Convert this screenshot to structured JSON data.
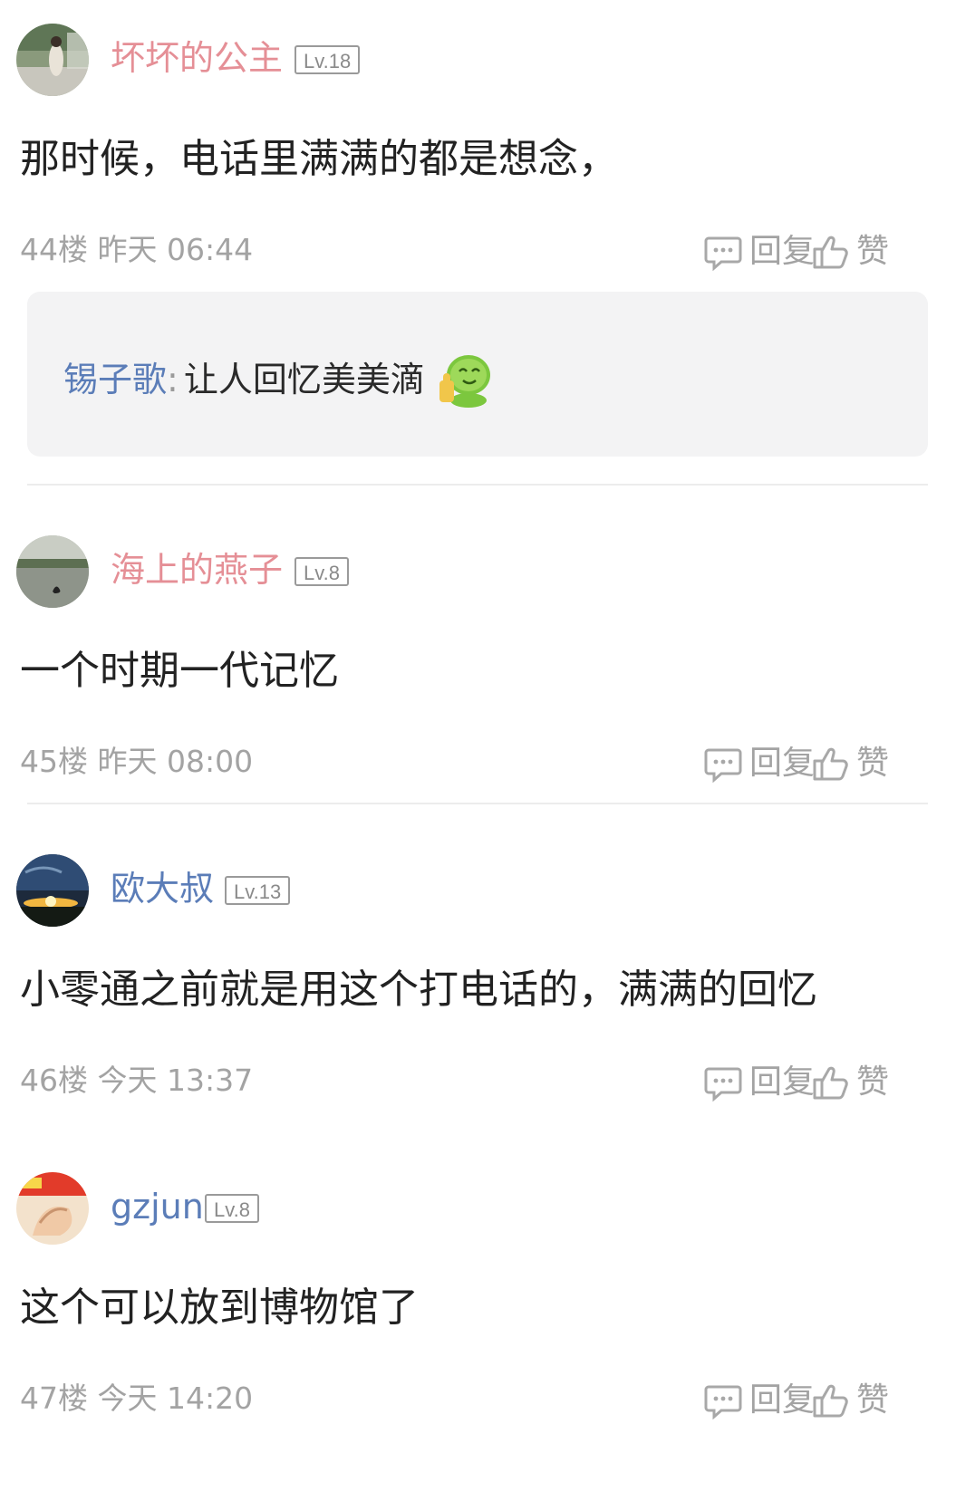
{
  "posts": [
    {
      "username": "坏坏的公主",
      "level": "Lv.18",
      "content": "那时候，电话里满满的都是想念，",
      "meta": "44楼 昨天 06:44",
      "reply_label": "回复",
      "like_label": "赞",
      "name_color": "#e58f96",
      "sub_reply": {
        "user": "锡子歌",
        "colon": ":",
        "text": "让人回忆美美滴",
        "emoji": "thumbs-up-green-emoji"
      }
    },
    {
      "username": "海上的燕子",
      "level": "Lv.8",
      "content": "一个时期一代记忆",
      "meta": "45楼 昨天 08:00",
      "reply_label": "回复",
      "like_label": "赞",
      "name_color": "#e58f96"
    },
    {
      "username": "欧大叔",
      "level": "Lv.13",
      "content": "小零通之前就是用这个打电话的，满满的回忆",
      "meta": "46楼 今天 13:37",
      "reply_label": "回复",
      "like_label": "赞",
      "name_color": "#5b7db8"
    },
    {
      "username": "gzjun",
      "level": "Lv.8",
      "content": "这个可以放到博物馆了",
      "meta": "47楼 今天 14:20",
      "reply_label": "回复",
      "like_label": "赞",
      "name_color": "#5b7db8"
    }
  ],
  "icons": {
    "reply": "comment-bubble-icon",
    "like": "thumbs-up-icon"
  }
}
